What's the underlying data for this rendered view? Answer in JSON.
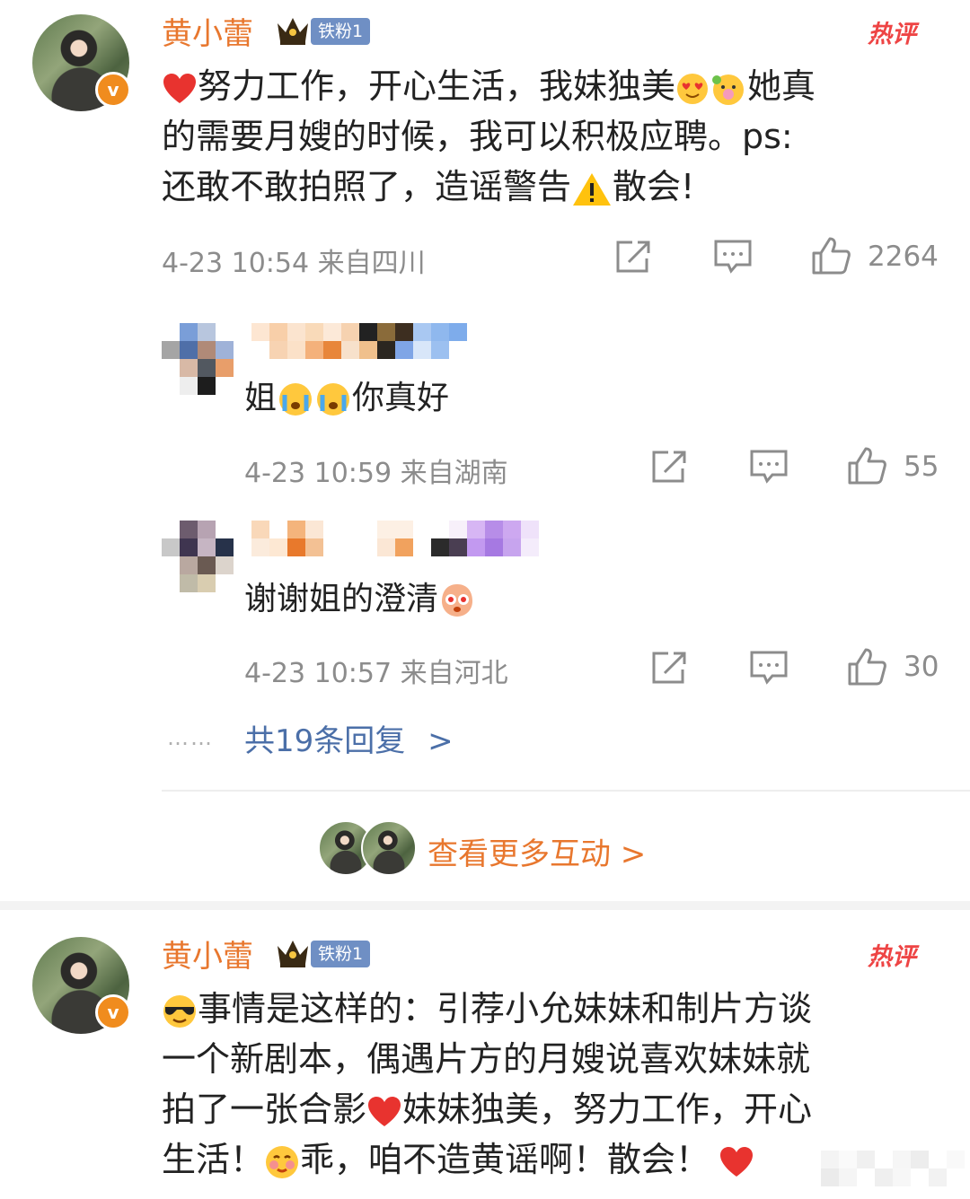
{
  "colors": {
    "username": "#e8772e",
    "link": "#4b6fa8",
    "hot": "#ee4444",
    "meta": "#8c8c8c"
  },
  "comment1": {
    "username": "黄小蕾",
    "fan_badge": "铁粉1",
    "hot_label": "热评",
    "text_parts": [
      "努力工作，开心生活，我妹独美",
      "她真的需要月嫂的时候，我可以积极应聘。ps: 还敢不敢拍照了，造谣警告",
      "散会!"
    ],
    "line1": "努力工作，开心生活，我妹独美",
    "line1b": "她真",
    "line2": "的需要月嫂的时候，我可以积极应聘。ps:",
    "line3a": "还敢不敢拍照了，造谣警告",
    "line3b": "散会!",
    "meta": "4-23 10:54 来自四川",
    "likes": "2264",
    "icons": [
      "share-icon",
      "comment-icon",
      "like-icon"
    ]
  },
  "replies": [
    {
      "text_a": "姐",
      "text_b": "你真好",
      "meta": "4-23 10:59 来自湖南",
      "likes": "55"
    },
    {
      "text_a": "谢谢姐的澄清",
      "meta": "4-23 10:57 来自河北",
      "likes": "30"
    }
  ],
  "more_replies": {
    "dots": "……",
    "label": "共19条回复",
    "chevron": ">"
  },
  "view_more": {
    "label": "查看更多互动 >"
  },
  "comment2": {
    "username": "黄小蕾",
    "fan_badge": "铁粉1",
    "hot_label": "热评",
    "line1": "事情是这样的：引荐小允妹妹和制片方谈",
    "line2": "一个新剧本，偶遇片方的月嫂说喜欢妹妹就",
    "line3a": "拍了一张合影",
    "line3b": "妹妹独美，努力工作，开心",
    "line4a": "生活！",
    "line4b": "乖，咱不造黄谣啊！散会！"
  }
}
